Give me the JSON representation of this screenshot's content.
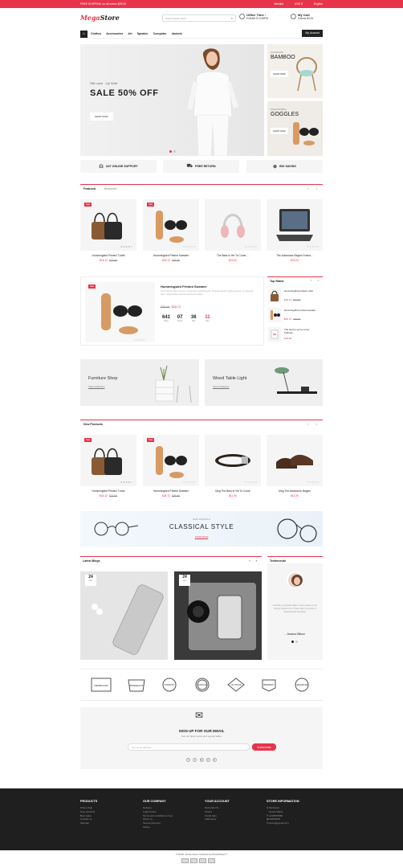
{
  "topbar": {
    "text": "FREE SHIPPING on all orders $29.00",
    "wishlist": "Wishlist",
    "currency": "USD $",
    "language": "English"
  },
  "header": {
    "logo_a": "Mega",
    "logo_b": "Store",
    "search_placeholder": "Search Entire Store",
    "office_title": "Office Time :",
    "office_hours": "9:00AM To 6:00PM",
    "cart_title": "My Cart",
    "cart_items": "0 items $0.00"
  },
  "nav": {
    "items": [
      "Clothes",
      "Accessories",
      "Art",
      "Speaker",
      "Computer",
      "Jackets"
    ],
    "account": "My Account"
  },
  "hero": {
    "subtitle": "Silk Lace - Up Shirt",
    "title": "SALE 50% OFF",
    "button": "SHOP NOW"
  },
  "side_banners": [
    {
      "small": "HANDMADE",
      "big": "BAMBOO",
      "button": "SHOP NOW"
    },
    {
      "small": "FASHIONABLE",
      "big": "GOGGLES",
      "button": "SHOP NOW"
    }
  ],
  "services": [
    "24/7 ONLINE SUPPORT",
    "FREE RETURN",
    "BIG SAVING"
  ],
  "featured": {
    "tabs": [
      "Featured",
      "Bestseller"
    ],
    "products": [
      {
        "name": "Hummingbird Printed T-shirt",
        "price": "$18.12",
        "old": "$23.90",
        "sale": "Sale"
      },
      {
        "name": "Hummingbird Printed Sweater",
        "price": "$28.72",
        "old": "$35.90",
        "sale": "Sale"
      },
      {
        "name": "The Best Is Yet To Come ...",
        "price": "$29.00",
        "old": "",
        "sale": ""
      },
      {
        "name": "The Adventure Begins Frame...",
        "price": "$29.00",
        "old": "",
        "sale": ""
      }
    ]
  },
  "deal": {
    "sale": "Sale",
    "name": "Hummingbird Printed Sweater",
    "desc": "Lorem ipsum dolor sit amet, consectetur adipiscing elit. Praesent iaculis mattis pharetra. Ut vitae sed diam. Suspendisse eleifend maximus tristique.",
    "old": "$35.90",
    "price": "$28.72",
    "countdown": [
      {
        "n": "641",
        "u": "Days"
      },
      {
        "n": "07",
        "u": "Hours"
      },
      {
        "n": "36",
        "u": "Min"
      },
      {
        "n": "11",
        "u": "Sec"
      }
    ]
  },
  "top_rated": {
    "title": "Top Rated",
    "items": [
      {
        "name": "Hummingbird printed t-shirt",
        "price": "$18.12",
        "old": "$23.90"
      },
      {
        "name": "Hummingbird printed sweater",
        "price": "$28.72",
        "old": "$35.90"
      },
      {
        "name": "The best is yet to come ' Framed...",
        "price": "$29.00",
        "old": ""
      }
    ]
  },
  "mid_banners": [
    {
      "title": "Furniture Shop",
      "link": "View Collection"
    },
    {
      "title": "Wood Table Light",
      "link": "View Collection"
    }
  ],
  "new_products": {
    "title": "New Products",
    "products": [
      {
        "name": "Hummingbird Printed T-shirt",
        "price": "$18.12",
        "old": "$23.90",
        "sale": "Sale"
      },
      {
        "name": "Hummingbird Printed Sweater",
        "price": "$28.72",
        "old": "$35.90",
        "sale": "Sale"
      },
      {
        "name": "Mug The Best Is Yet To Come",
        "price": "$11.90",
        "old": "",
        "sale": ""
      },
      {
        "name": "Mug The Adventure Begins",
        "price": "$11.90",
        "old": "",
        "sale": ""
      }
    ]
  },
  "classic": {
    "small": "NEW ARRIVALS",
    "big": "CLASSICAL STYLE",
    "shop": "SHOP NOW"
  },
  "blogs": {
    "title": "Latest Blogs",
    "posts": [
      {
        "day": "24",
        "month": "Apr"
      },
      {
        "day": "24",
        "month": "Apr"
      }
    ]
  },
  "testimonial": {
    "title": "Testimonial",
    "text": "Contrary to popular belief, Lorem Ipsum is not simply random text. It has roots in a piece of classical Latin literature.",
    "name": "- Jessica Wilson"
  },
  "brands": [
    "HERBALISM",
    "BORDEAUX",
    "COMPANY",
    "VINTAGE",
    "OUTDOOR",
    "BREWERY",
    "HANDMADE"
  ],
  "newsletter": {
    "title": "SIGN UP FOR OUR EMAIL",
    "subtitle": "Get our latest news and special sales",
    "placeholder": "Your email address",
    "button": "SUBSCRIBE",
    "social": [
      "f",
      "t",
      "g+",
      "y",
      "p"
    ]
  },
  "footer": {
    "cols": [
      {
        "title": "PRODUCTS",
        "items": [
          "Prices drop",
          "New products",
          "Best sales",
          "Contact us",
          "Sitemap"
        ]
      },
      {
        "title": "OUR COMPANY",
        "items": [
          "Delivery",
          "Legal Notice",
          "Terms and conditions of use",
          "About us",
          "Secure payment",
          "Stores"
        ]
      },
      {
        "title": "YOUR ACCOUNT",
        "items": [
          "Personal info",
          "Orders",
          "Credit slips",
          "Addresses"
        ]
      },
      {
        "title": "STORE INFORMATION",
        "items": [
          "Multistore",
          "United States",
          "1234567890",
          "00000000",
          "demo@gmail.com"
        ]
      }
    ],
    "copyright": "© 2018 - Ecommerce software by PrestaShop™"
  },
  "colors": {
    "accent": "#e8344a",
    "dark": "#1f1f1f"
  }
}
